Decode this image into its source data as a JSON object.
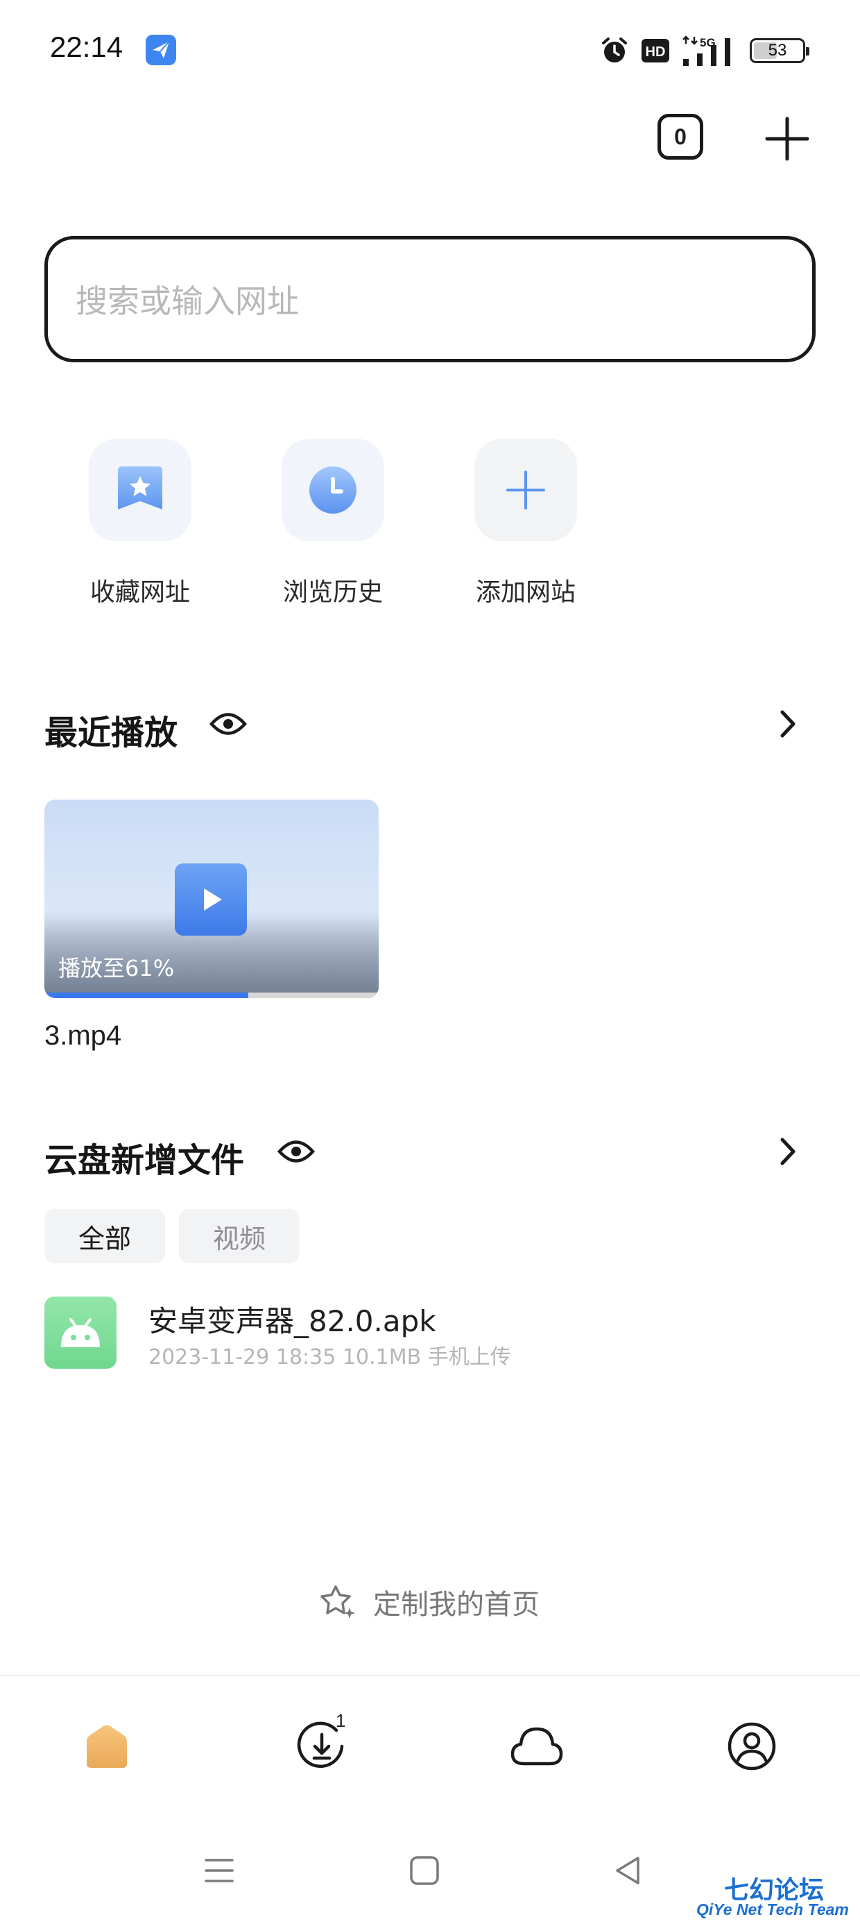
{
  "status_bar": {
    "time": "22:14",
    "network": "5G",
    "battery": "53",
    "battery_level": 0.53,
    "icons": [
      "app-notification-icon",
      "alarm-icon",
      "hd-icon",
      "signal-icon",
      "battery-icon"
    ]
  },
  "top_actions": {
    "tab_count": "0",
    "new_tab_icon": "plus-icon"
  },
  "search": {
    "placeholder": "搜索或输入网址"
  },
  "shortcuts": [
    {
      "label": "收藏网址",
      "icon": "bookmark-star-icon"
    },
    {
      "label": "浏览历史",
      "icon": "clock-icon"
    },
    {
      "label": "添加网站",
      "icon": "plus-icon"
    }
  ],
  "recent_play": {
    "title": "最近播放",
    "video": {
      "progress_label": "播放至61%",
      "progress": 0.61,
      "name": "3.mp4"
    }
  },
  "cloud_new_files": {
    "title": "云盘新增文件",
    "filters": [
      "全部",
      "视频"
    ],
    "active_filter": 0,
    "files": [
      {
        "name": "安卓变声器_82.0.apk",
        "date": "2023-11-29 18:35",
        "size": "10.1MB",
        "source": "手机上传"
      }
    ]
  },
  "customize": {
    "label": "定制我的首页"
  },
  "bottom_nav": {
    "items": [
      "home-icon",
      "download-icon",
      "cloud-icon",
      "profile-icon"
    ],
    "download_badge": "1"
  },
  "system_nav": [
    "menu-icon",
    "home-square-icon",
    "back-icon"
  ],
  "watermark": {
    "title": "七幻论坛",
    "subtitle": "QiYe Net Tech Team"
  },
  "colors": {
    "accent": "#3a78ef",
    "home_icon": "#f0b768",
    "apk_icon": "#7ddc98"
  }
}
